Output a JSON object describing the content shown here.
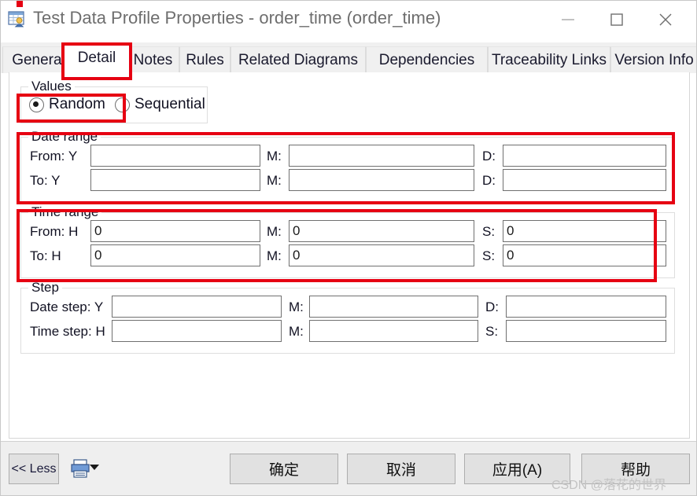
{
  "window": {
    "title": "Test Data Profile Properties - order_time (order_time)",
    "icon": "table-person-icon",
    "controls": {
      "minimize": "minimize-icon",
      "maximize": "maximize-icon",
      "close": "close-icon"
    }
  },
  "tabs": [
    {
      "label": "General",
      "active": false
    },
    {
      "label": "Detail",
      "active": true
    },
    {
      "label": "Notes",
      "active": false
    },
    {
      "label": "Rules",
      "active": false
    },
    {
      "label": "Related Diagrams",
      "active": false
    },
    {
      "label": "Dependencies",
      "active": false
    },
    {
      "label": "Traceability Links",
      "active": false
    },
    {
      "label": "Version Info",
      "active": false
    }
  ],
  "values_group": {
    "legend": "Values",
    "options": [
      {
        "label": "Random",
        "selected": true
      },
      {
        "label": "Sequential",
        "selected": false
      }
    ]
  },
  "date_range": {
    "legend": "Date range",
    "rows": [
      {
        "prefix": "From:",
        "f1_label": "Y",
        "f1_value": "",
        "f2_label": "M:",
        "f2_value": "",
        "f3_label": "D:",
        "f3_value": ""
      },
      {
        "prefix": "To:",
        "f1_label": "Y",
        "f1_value": "",
        "f2_label": "M:",
        "f2_value": "",
        "f3_label": "D:",
        "f3_value": ""
      }
    ]
  },
  "time_range": {
    "legend": "Time range",
    "rows": [
      {
        "prefix": "From:",
        "f1_label": "H",
        "f1_value": "0",
        "f2_label": "M:",
        "f2_value": "0",
        "f3_label": "S:",
        "f3_value": "0"
      },
      {
        "prefix": "To:",
        "f1_label": "H",
        "f1_value": "0",
        "f2_label": "M:",
        "f2_value": "0",
        "f3_label": "S:",
        "f3_value": "0"
      }
    ]
  },
  "step": {
    "legend": "Step",
    "rows": [
      {
        "prefix": "Date step:",
        "f1_label": "Y",
        "f1_value": "",
        "f2_label": "M:",
        "f2_value": "",
        "f3_label": "D:",
        "f3_value": ""
      },
      {
        "prefix": "Time step:",
        "f1_label": "H",
        "f1_value": "",
        "f2_label": "M:",
        "f2_value": "",
        "f3_label": "S:",
        "f3_value": ""
      }
    ]
  },
  "footer": {
    "less_label": "<< Less",
    "print_icon": "print-icon",
    "dropdown_icon": "caret-down-icon",
    "ok_label": "确定",
    "cancel_label": "取消",
    "apply_label": "应用(A)",
    "help_label": "帮助"
  },
  "watermark": "CSDN @落花的世界",
  "annotation_color": "#e60012"
}
